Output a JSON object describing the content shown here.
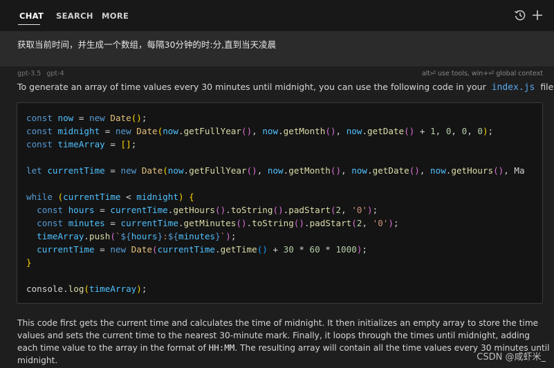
{
  "tabs": [
    {
      "label": "CHAT",
      "active": true
    },
    {
      "label": "SEARCH",
      "active": false
    },
    {
      "label": "MORE",
      "active": false
    }
  ],
  "toolbar_icons": [
    "history-icon",
    "plus-icon"
  ],
  "prompt": {
    "text": "获取当前时间，并生成一个数组，每隔30分钟的时:分,直到当天凌晨"
  },
  "response": {
    "models": [
      "gpt-3.5",
      "gpt-4"
    ],
    "hints": "alt⏎ use tools, win+⏎ global context",
    "intro_before": "To generate an array of time values every 30 minutes until midnight, you can use the following code in your",
    "intro_file": "index.js",
    "intro_after": "file:",
    "code_lines": [
      "const now = new Date();",
      "const midnight = new Date(now.getFullYear(), now.getMonth(), now.getDate() + 1, 0, 0, 0);",
      "const timeArray = [];",
      "",
      "let currentTime = new Date(now.getFullYear(), now.getMonth(), now.getDate(), now.getHours(), Ma",
      "",
      "while (currentTime < midnight) {",
      "  const hours = currentTime.getHours().toString().padStart(2, '0');",
      "  const minutes = currentTime.getMinutes().toString().padStart(2, '0');",
      "  timeArray.push(`${hours}:${minutes}`);",
      "  currentTime = new Date(currentTime.getTime() + 30 * 60 * 1000);",
      "}",
      "",
      "console.log(timeArray);"
    ],
    "outro_before": "This code first gets the current time and calculates the time of midnight. It then initializes an empty array to store the time values and sets the current time to the nearest 30-minute mark. Finally, it loops through the times until midnight, adding each time value to the array in the format of",
    "outro_format": "HH:MM",
    "outro_after": ". The resulting array will contain all the time values every 30 minutes until midnight."
  },
  "watermark": "CSDN @咸虾米_",
  "colors": {
    "background": "#1e1e1e",
    "prompt_bg": "#2b2b2b",
    "code_bg": "#141414",
    "inline_code": "#5aa9f0"
  }
}
